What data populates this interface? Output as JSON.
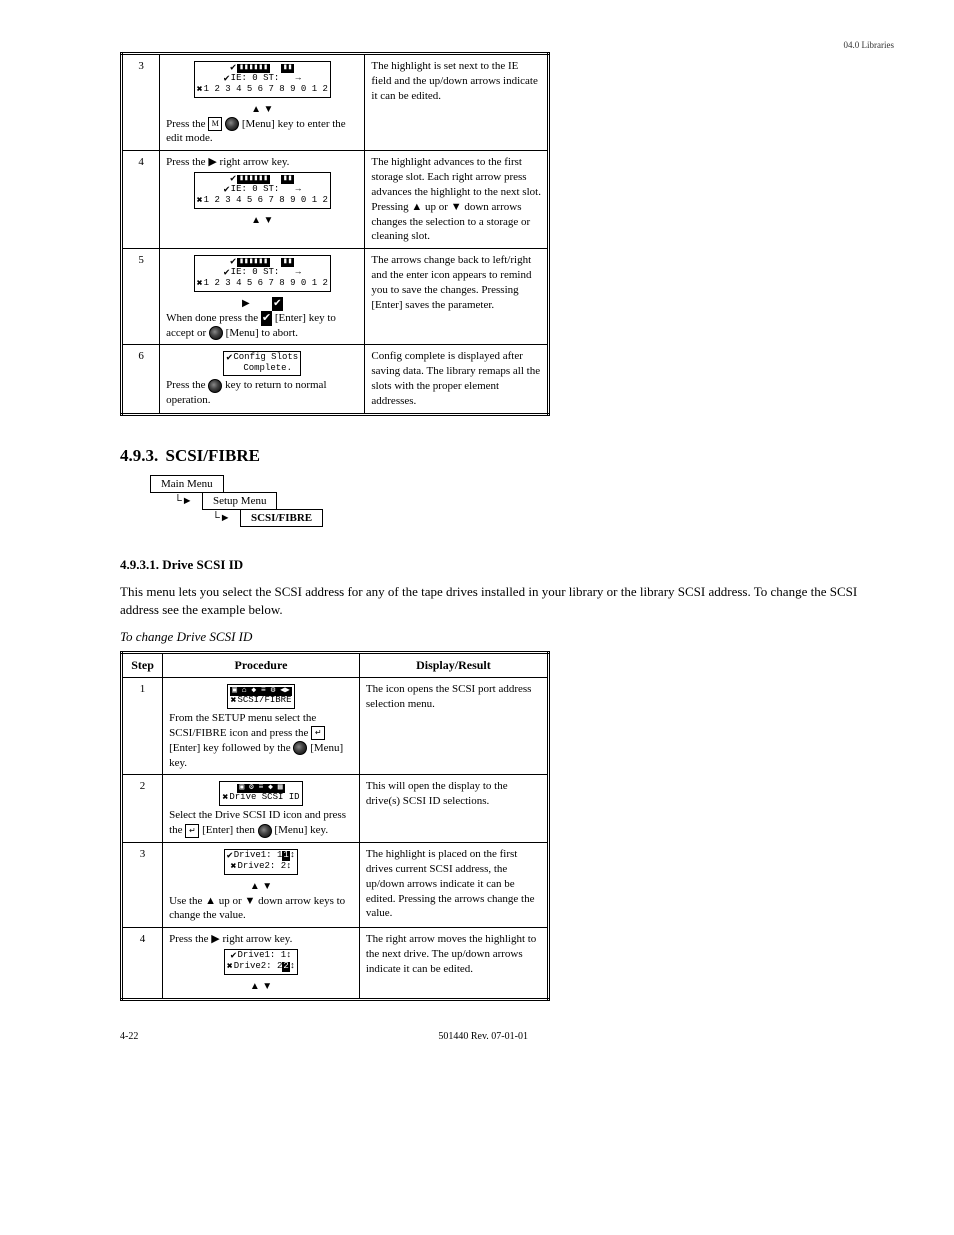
{
  "running_head": "04.0 Libraries",
  "sections": {
    "main": {
      "num": "4.9.3.",
      "title": "SCSI/FIBRE"
    },
    "sub": {
      "num": "4.9.3.1.",
      "title": "Drive SCSI ID"
    }
  },
  "flow": {
    "b1": "Main Menu",
    "b2": "Setup Menu",
    "b3": "SCSI/FIBRE"
  },
  "note_text": "This menu lets you select the SCSI address for any of the tape drives installed in your library or the library SCSI address. To change the SCSI address see the example below.",
  "caption": "To change Drive SCSI ID",
  "table1": {
    "rows": [
      {
        "step": "3",
        "proc_intro": "Press the",
        "proc_rest": "[Menu] key to enter the edit mode.",
        "knob_after_intro": true,
        "lcd": {
          "top": "IE: 0   ST:",
          "bot": "1 2 3 4 5 6 7 8 9 0 1 2"
        },
        "arrows": "▲    ▼",
        "result": "The highlight is set next to the IE field and the up/down arrows indicate it can be edited."
      },
      {
        "step": "4",
        "proc_intro": "Press the ▶ right arrow key.",
        "lcd": {
          "top": "IE: 0   ST:",
          "bot": "1 2 3 4 5 6 7 8 9 0 1 2"
        },
        "arrows": "▲    ▼",
        "result": "The highlight advances to the first storage slot. Each right arrow press advances the highlight to the next slot. Pressing ▲ up or ▼ down arrows changes the selection to a storage or cleaning slot."
      },
      {
        "step": "5",
        "proc_intro": "When done press the",
        "proc_mid": "[Enter] key to accept or",
        "knob_after_mid": true,
        "proc_end": "[Menu] to abort.",
        "lcd": {
          "top": "IE: 0   ST:",
          "bot": "1 2 3 4 5 6 7 8 9 0 1 2"
        },
        "arrows": "▶",
        "tick_after": true,
        "result": "The arrows change back to left/right and the enter icon appears to remind you to save the changes. Pressing [Enter] saves the parameter."
      },
      {
        "step": "6",
        "lcd_text": [
          "Config Slots",
          "Complete."
        ],
        "proc_intro": "Press the",
        "knob_after_intro": true,
        "proc_rest": "key to return to normal operation.",
        "result": "Config complete is displayed after saving data. The library remaps all the slots with the proper element addresses."
      }
    ]
  },
  "table2": {
    "ths": [
      "Step",
      "Procedure",
      "Display/Result"
    ],
    "rows": [
      {
        "step": "1",
        "lcd": {
          "top": "icons",
          "bot": "SCSI/FIBRE"
        },
        "proc_intro": "From the SETUP menu select the SCSI/FIBRE icon and press the",
        "enter_icon": true,
        "proc_mid": "[Enter] key followed by the",
        "knob_after_mid": true,
        "proc_end": "[Menu] key.",
        "result": "The icon opens the SCSI port address selection menu."
      },
      {
        "step": "2",
        "lcd": {
          "top": "icons2",
          "bot": "Drive SCSI ID"
        },
        "proc_intro": "Select the Drive SCSI ID icon and press the",
        "enter_icon": true,
        "proc_mid": "[Enter] then",
        "knob_after_mid": true,
        "proc_end": "[Menu] key.",
        "result": "This will open the display to the drive(s) SCSI ID selections."
      },
      {
        "step": "3",
        "lcd_text": [
          "Drive1: 1",
          "Drive2: 2"
        ],
        "arrows": "▲    ▼",
        "proc_intro": "Use the ▲ up or ▼ down arrow keys to change the value.",
        "result": "The highlight is placed on the first drives current SCSI address, the up/down arrows indicate it can be edited. Pressing the arrows change the value."
      },
      {
        "step": "4",
        "proc_intro": "Press the ▶ right arrow key.",
        "lcd_text_after": [
          "Drive1: 1",
          "Drive2: 2"
        ],
        "arrows_after": "▲    ▼",
        "result": "The right arrow moves the highlight to the next drive. The up/down arrows indicate it can be edited."
      }
    ]
  },
  "page_num": "4-22",
  "doc_id": "501440 Rev. 07-01-01"
}
